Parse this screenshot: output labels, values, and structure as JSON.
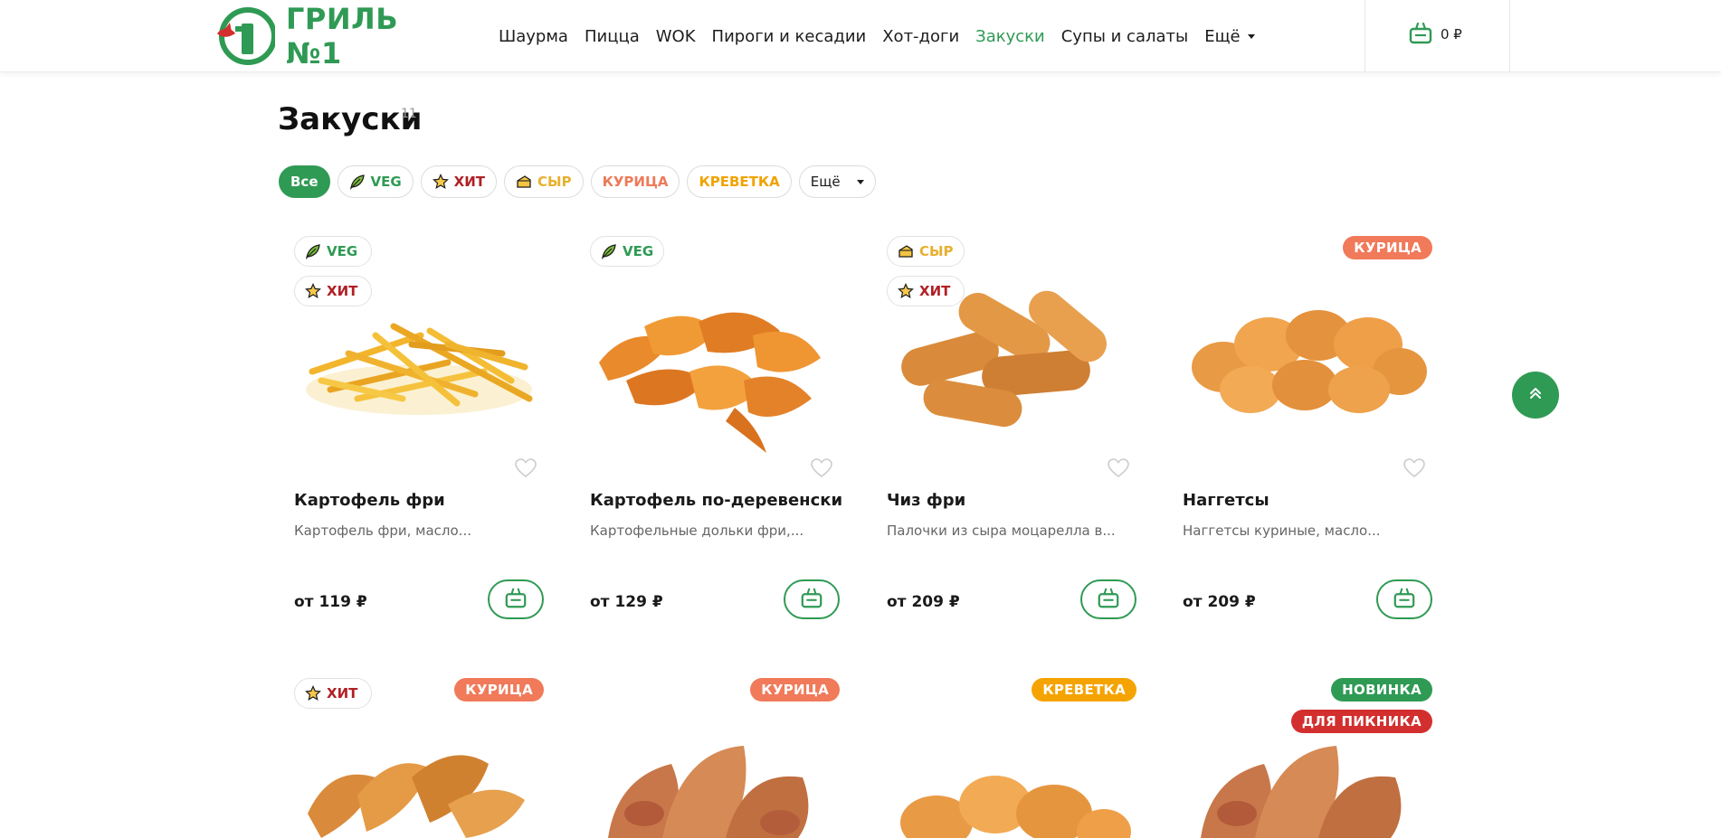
{
  "header": {
    "logo_text": "ГРИЛЬ №1",
    "nav": [
      "Шаурма",
      "Пицца",
      "WOK",
      "Пироги и кесадии",
      "Хот-доги",
      "Закуски",
      "Супы и салаты"
    ],
    "nav_active": "Закуски",
    "nav_more": "Ещё",
    "cart_amount": "0 ₽"
  },
  "page": {
    "title": "Закуски",
    "count": "11"
  },
  "filters": {
    "all": "Все",
    "veg": "VEG",
    "hit": "ХИТ",
    "cheese": "СЫР",
    "chicken": "КУРИЦА",
    "shrimp": "КРЕВЕТКА",
    "more": "Ещё"
  },
  "products": [
    {
      "name": "Картофель фри",
      "desc": "Картофель фри, масло...",
      "price": "от 119 ₽",
      "badges": [
        "VEG",
        "ХИТ"
      ]
    },
    {
      "name": "Картофель по-деревенски",
      "desc": "Картофельные дольки фри,...",
      "price": "от 129 ₽",
      "badges": [
        "VEG"
      ]
    },
    {
      "name": "Чиз фри",
      "desc": "Палочки из сыра моцарелла в...",
      "price": "от 209 ₽",
      "badges": [
        "СЫР",
        "ХИТ"
      ]
    },
    {
      "name": "Наггетсы",
      "desc": "Наггетсы куриные, масло...",
      "price": "от 209 ₽",
      "tag": "КУРИЦА"
    }
  ],
  "row2": [
    {
      "badge": "ХИТ",
      "tag": "КУРИЦА"
    },
    {
      "tag": "КУРИЦА"
    },
    {
      "tag": "КРЕВЕТКА"
    },
    {
      "tag": "НОВИНКА",
      "tag2": "ДЛЯ ПИКНИКА"
    }
  ],
  "colors": {
    "brand_green": "#2f9a54",
    "tag_chicken": "#f07a5a",
    "tag_shrimp": "#f5a300",
    "tag_new": "#2f9a54",
    "tag_picnic": "#d32f2f"
  },
  "icons": [
    "logo-mark",
    "cart-icon",
    "leaf-icon",
    "star-icon",
    "cheese-icon",
    "heart-icon",
    "basket-icon",
    "arrow-up-icon",
    "chevron-down-icon"
  ]
}
